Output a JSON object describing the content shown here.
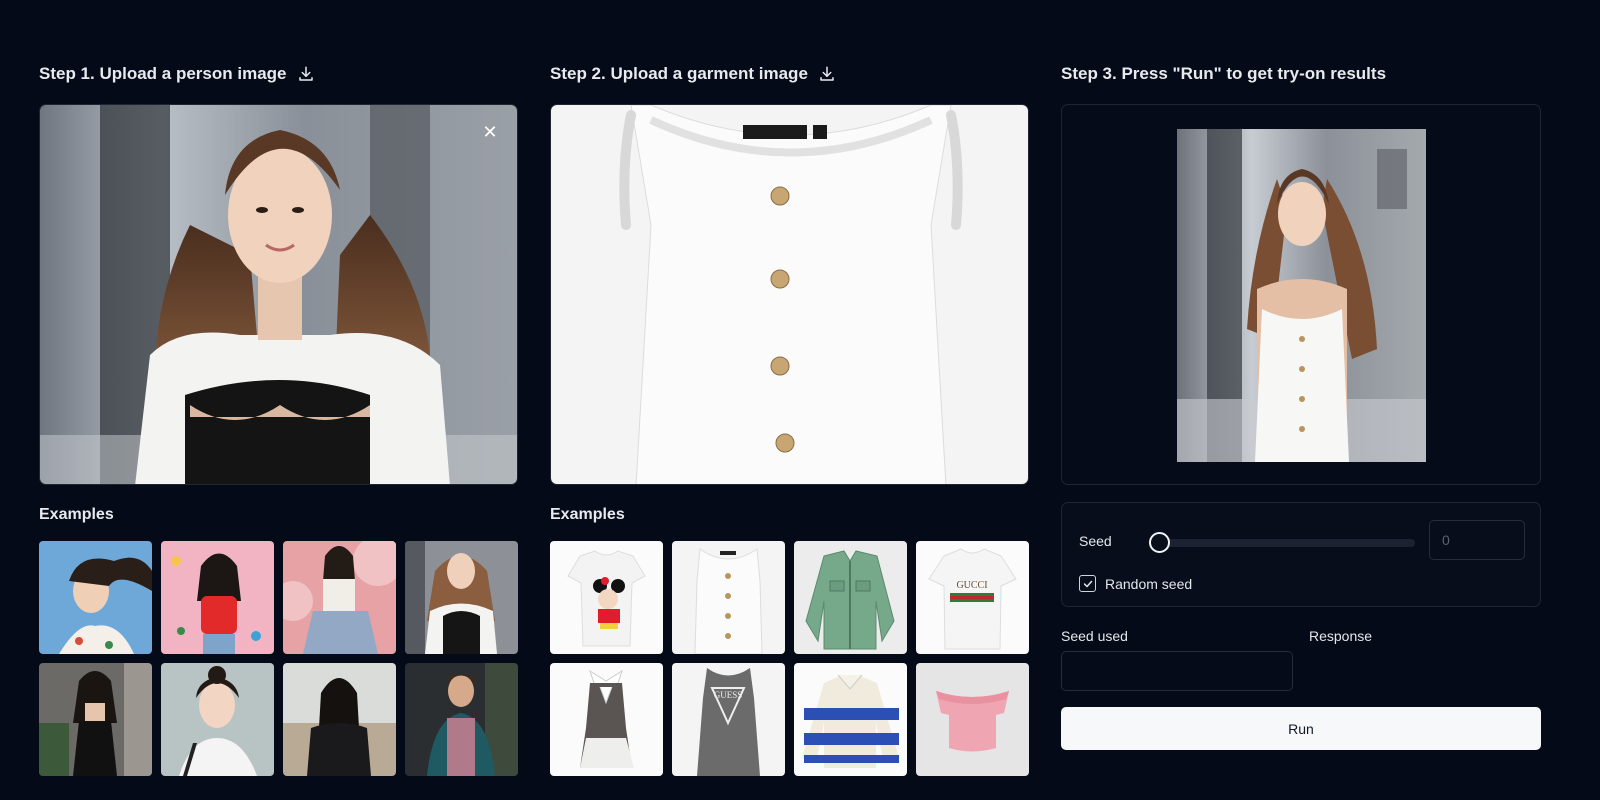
{
  "step1": {
    "title": "Step 1. Upload a person image",
    "examples_label": "Examples",
    "close_glyph": "✕"
  },
  "step2": {
    "title": "Step 2. Upload a garment image",
    "examples_label": "Examples"
  },
  "step3": {
    "title": "Step 3. Press \"Run\" to get try-on results"
  },
  "person_examples": [
    {
      "name": "person-example-1"
    },
    {
      "name": "person-example-2"
    },
    {
      "name": "person-example-3"
    },
    {
      "name": "person-example-4"
    },
    {
      "name": "person-example-5"
    },
    {
      "name": "person-example-6"
    },
    {
      "name": "person-example-7"
    },
    {
      "name": "person-example-8"
    }
  ],
  "garment_examples": [
    {
      "name": "garment-example-minnie-tee",
      "print": ""
    },
    {
      "name": "garment-example-white-tank",
      "print": ""
    },
    {
      "name": "garment-example-green-jacket",
      "print": ""
    },
    {
      "name": "garment-example-gucci-tee",
      "print": "GUCCI"
    },
    {
      "name": "garment-example-collar-dress",
      "print": ""
    },
    {
      "name": "garment-example-guess-tank",
      "print": "GUESS"
    },
    {
      "name": "garment-example-striped-sweater",
      "print": ""
    },
    {
      "name": "garment-example-pink-top",
      "print": ""
    }
  ],
  "controls": {
    "seed_label": "Seed",
    "seed_value": "0",
    "seed_slider_level": 0,
    "random_seed_label": "Random seed",
    "random_seed_checked": true,
    "seed_used_label": "Seed used",
    "response_label": "Response",
    "run_label": "Run"
  },
  "colors": {
    "background": "#040a17",
    "panel_border": "#1e2533",
    "run_button": "#f7f8fa"
  }
}
